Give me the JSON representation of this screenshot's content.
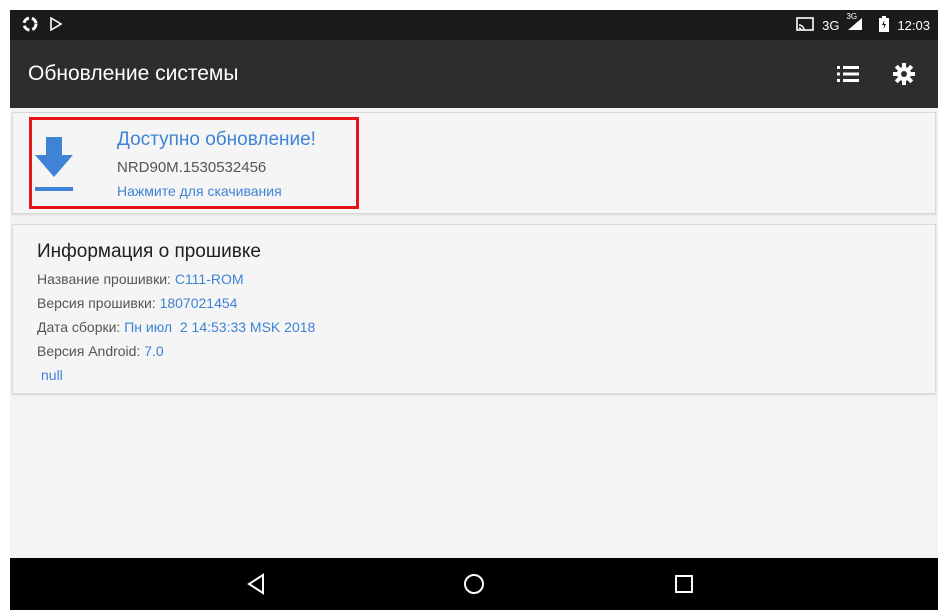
{
  "status_bar": {
    "network": "3G",
    "network_sup": "3G",
    "time": "12:03"
  },
  "app_bar": {
    "title": "Обновление системы",
    "icons": [
      "list-icon",
      "gear-icon"
    ]
  },
  "update_card": {
    "title": "Доступно обновление!",
    "build": "NRD90M.1530532456",
    "hint": "Нажмите для скачивания",
    "icon": "download-icon"
  },
  "firmware_card": {
    "title": "Информация о прошивке",
    "rows": [
      {
        "label": "Название прошивки: ",
        "value": "C111-ROM"
      },
      {
        "label": "Версия прошивки: ",
        "value": "1807021454"
      },
      {
        "label": "Дата сборки: ",
        "value": "Пн июл  2 14:53:33 MSK 2018"
      },
      {
        "label": "Версия Android: ",
        "value": "7.0"
      }
    ],
    "extra": "null"
  },
  "nav_bar": {
    "buttons": [
      "back-icon",
      "home-icon",
      "recents-icon"
    ]
  },
  "colors": {
    "accent": "#3f83d6",
    "highlight": "#e8141b",
    "action_bar": "#2d2d2d",
    "status_bar": "#1b1b1b"
  }
}
